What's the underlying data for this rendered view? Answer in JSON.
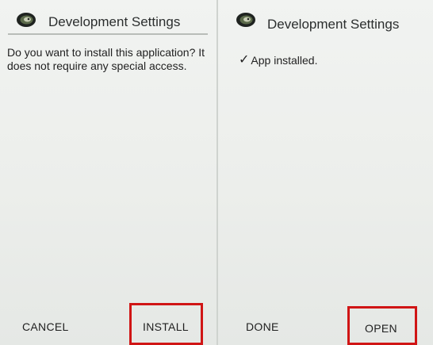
{
  "left_screen": {
    "title": "Development Settings",
    "app_icon": "chameleon-logo-icon",
    "message": "Do you want to install this application? It does not require any special access.",
    "buttons": {
      "cancel": "CANCEL",
      "install": "INSTALL"
    }
  },
  "right_screen": {
    "title": "Development Settings",
    "app_icon": "chameleon-logo-icon",
    "status_check": "✓",
    "status": "App installed.",
    "buttons": {
      "done": "DONE",
      "open": "OPEN"
    }
  },
  "colors": {
    "highlight": "#d01515",
    "background": "#eceeeb",
    "text": "#222222"
  }
}
